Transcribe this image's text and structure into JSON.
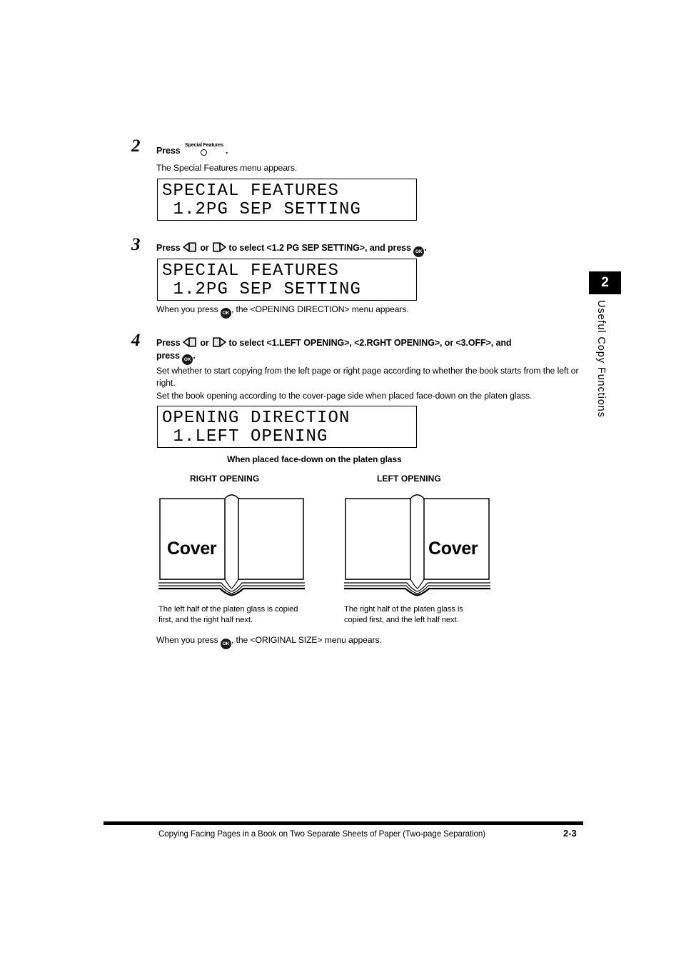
{
  "steps": [
    {
      "number": "2",
      "head_prefix": "Press",
      "button_label": "Special Features",
      "head_suffix": ".",
      "body": "The Special Features menu appears.",
      "lcd": {
        "line1": "SPECIAL FEATURES",
        "line2": " 1.2PG SEP SETTING"
      }
    },
    {
      "number": "3",
      "head_a": "Press",
      "head_or": "or",
      "head_b": "to select <1.2 PG SEP SETTING>, and press",
      "head_end": ".",
      "lcd": {
        "line1": "SPECIAL FEATURES",
        "line2": " 1.2PG SEP SETTING"
      },
      "note_a": "When you press",
      "note_b": ", the <OPENING DIRECTION> menu appears."
    },
    {
      "number": "4",
      "head_a": "Press",
      "head_or": "or",
      "head_b": "to select <1.LEFT OPENING>, <2.RGHT OPENING>, or <3.OFF>, and",
      "head_c": "press",
      "head_end": ".",
      "body1": "Set whether to start copying from the left page or right page according to whether the book starts from the left or right.",
      "body2": "Set the book opening according to the cover-page side when placed face-down on the platen glass.",
      "lcd": {
        "line1": "OPENING DIRECTION",
        "line2": " 1.LEFT OPENING"
      },
      "note_a": "When you press",
      "note_b": ", the <ORIGINAL SIZE> menu appears."
    }
  ],
  "figure": {
    "caption": "When placed face-down on the platen glass",
    "left": {
      "title": "RIGHT OPENING",
      "cover_label": "Cover",
      "note": "The left half of the platen glass is copied first, and the right half next."
    },
    "right": {
      "title": "LEFT OPENING",
      "cover_label": "Cover",
      "note": "The right half of the platen glass is copied first, and the left half next."
    }
  },
  "chapter": {
    "number": "2",
    "title": "Useful Copy Functions"
  },
  "footer": {
    "text": "Copying Facing Pages in a Book on Two Separate Sheets of Paper (Two-page Separation)",
    "page": "2-3"
  },
  "icons": {
    "ok": "OK"
  }
}
